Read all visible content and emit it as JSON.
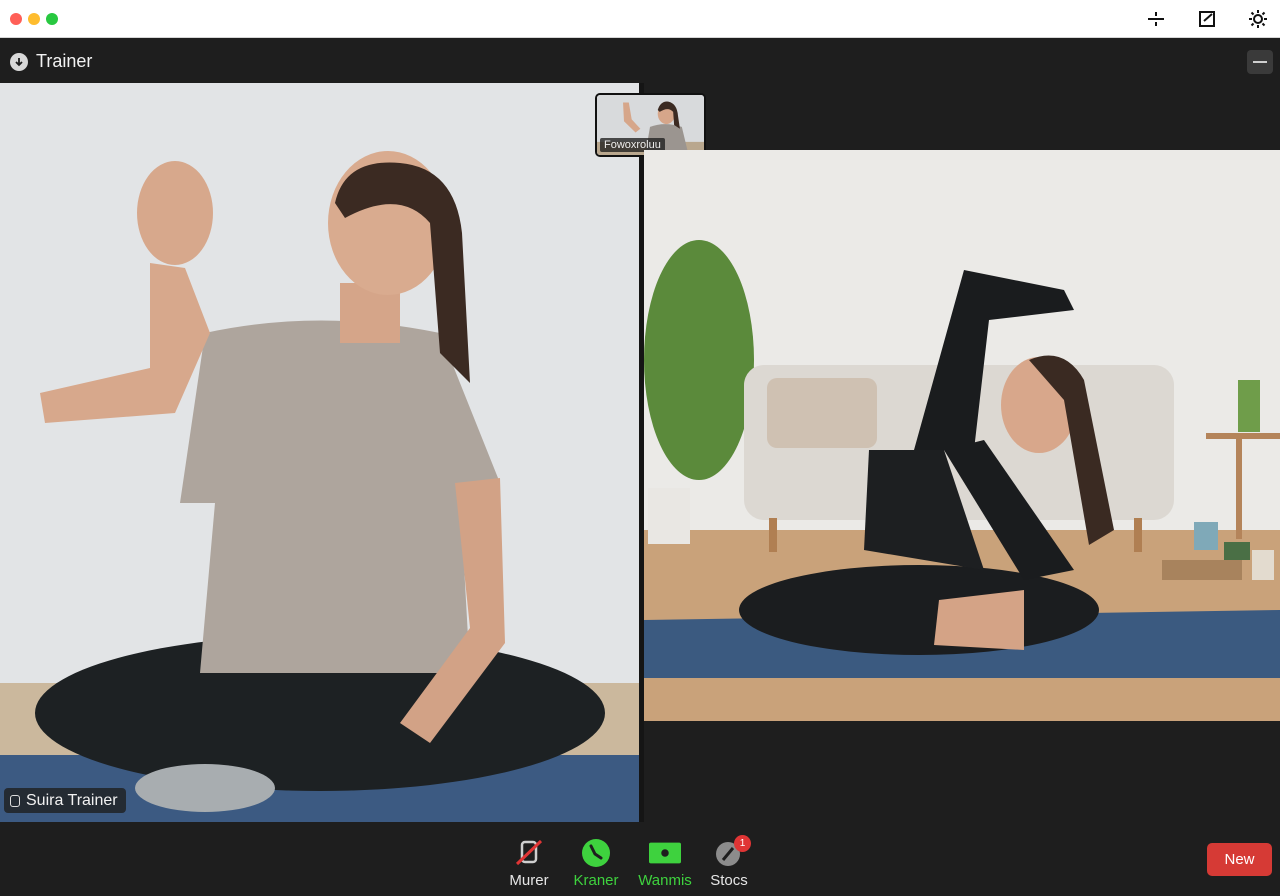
{
  "window": {
    "title": "Trainer",
    "toolbar_icons": [
      "split-view-icon",
      "edit-square-icon",
      "settings-gear-icon"
    ]
  },
  "participants": {
    "main": {
      "name": "Suira Trainer"
    },
    "thumbnail": {
      "name": "Fowoxroluu"
    }
  },
  "controls": [
    {
      "label": "Murer",
      "icon": "mute-mic-icon"
    },
    {
      "label": "Kraner",
      "icon": "phone-green-icon"
    },
    {
      "label": "Wanmis",
      "icon": "camera-green-icon"
    },
    {
      "label": "Stocs",
      "icon": "share-icon",
      "badge": "1"
    }
  ],
  "new_button": {
    "label": "New"
  },
  "colors": {
    "accent_green": "#3ed23e",
    "danger_red": "#d63a35",
    "background": "#1e1e1e"
  }
}
